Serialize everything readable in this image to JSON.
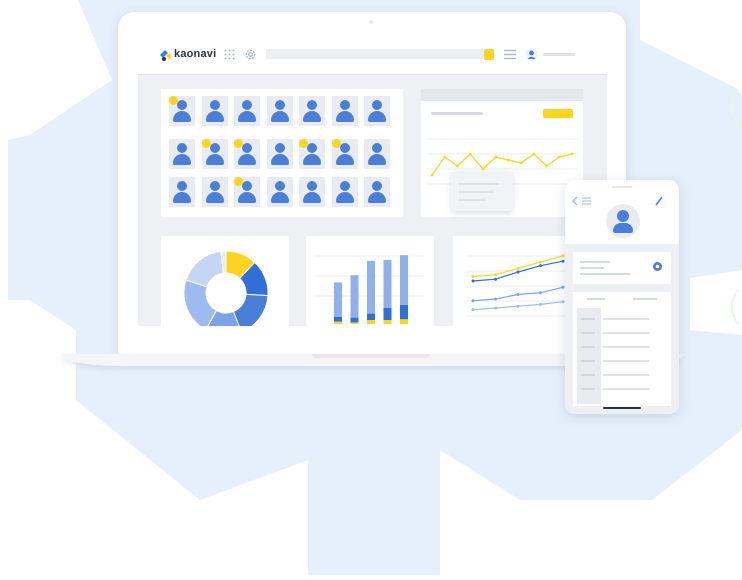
{
  "app": {
    "logo_text": "kaonavi",
    "accent_color": "#ffd421",
    "primary_color": "#4a7fd8",
    "background_gear_color": "#e6f0fc"
  },
  "header": {
    "icons": [
      "apps-grid-icon",
      "gear-icon",
      "search-button-icon",
      "menu-icon",
      "user-avatar-icon"
    ]
  },
  "people_grid": {
    "rows": 3,
    "columns": 7,
    "badged_cells": [
      [
        0,
        0
      ],
      [
        1,
        1
      ],
      [
        1,
        2
      ],
      [
        1,
        4
      ],
      [
        1,
        5
      ],
      [
        2,
        2
      ]
    ]
  },
  "donut_chart": {
    "type": "pie",
    "values": [
      12,
      14,
      18,
      14,
      22,
      18,
      2
    ],
    "colors": [
      "#ffd421",
      "#2f6fd6",
      "#4a7fd8",
      "#7da3e6",
      "#9dbbee",
      "#c4d6f4",
      "#e7edf8"
    ]
  },
  "bar_chart": {
    "type": "bar",
    "bars": [
      {
        "light": 0.43,
        "dark": 0.06,
        "yellow": 0.03
      },
      {
        "light": 0.53,
        "dark": 0.06,
        "yellow": 0.02
      },
      {
        "light": 0.66,
        "dark": 0.08,
        "yellow": 0.05
      },
      {
        "light": 0.6,
        "dark": 0.15,
        "yellow": 0.05
      },
      {
        "light": 0.62,
        "dark": 0.18,
        "yellow": 0.06
      }
    ]
  },
  "line_chart": {
    "type": "line",
    "series": [
      {
        "color": "#ffd421",
        "values": [
          0.55,
          0.57,
          0.64,
          0.71,
          0.78
        ]
      },
      {
        "color": "#2f6fd6",
        "values": [
          0.5,
          0.52,
          0.6,
          0.67,
          0.72
        ]
      },
      {
        "color": "#7da3e6",
        "values": [
          0.28,
          0.3,
          0.35,
          0.37,
          0.43
        ]
      },
      {
        "color": "#9dbbee",
        "values": [
          0.18,
          0.2,
          0.22,
          0.24,
          0.27
        ]
      }
    ]
  },
  "trend_chart": {
    "type": "line",
    "values": [
      0.15,
      0.45,
      0.3,
      0.5,
      0.25,
      0.45,
      0.4,
      0.35,
      0.5,
      0.3,
      0.45,
      0.5
    ]
  }
}
